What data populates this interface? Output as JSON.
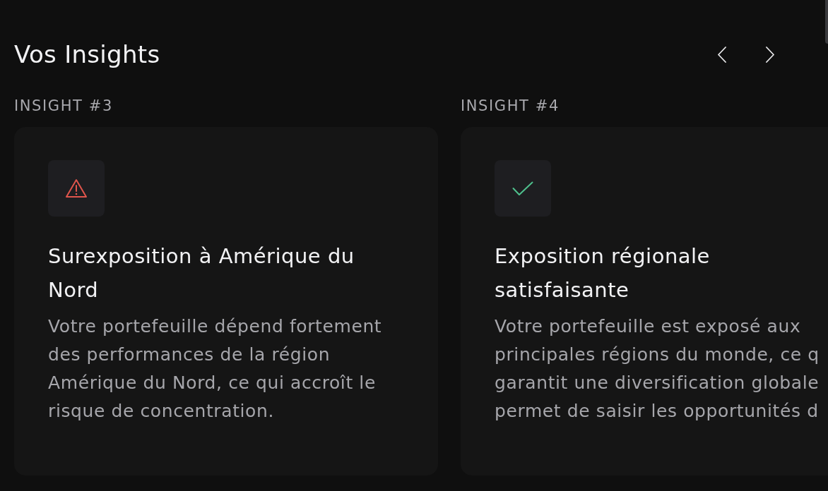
{
  "header": {
    "title": "Vos Insights"
  },
  "insights": [
    {
      "label": "INSIGHT #3",
      "kind": "warning",
      "title": "Surexposition à Amérique du Nord",
      "description_lines": [
        "Votre portefeuille dépend fortement",
        "des performances de la région",
        "Amérique du Nord, ce qui accroît le",
        "risque de concentration."
      ]
    },
    {
      "label": "INSIGHT #4",
      "kind": "success",
      "title": "Exposition régionale satisfaisante",
      "description_lines": [
        "Votre portefeuille est exposé aux",
        "principales régions du monde, ce q",
        "garantit une diversification globale",
        "permet de saisir les opportunités d"
      ]
    }
  ]
}
